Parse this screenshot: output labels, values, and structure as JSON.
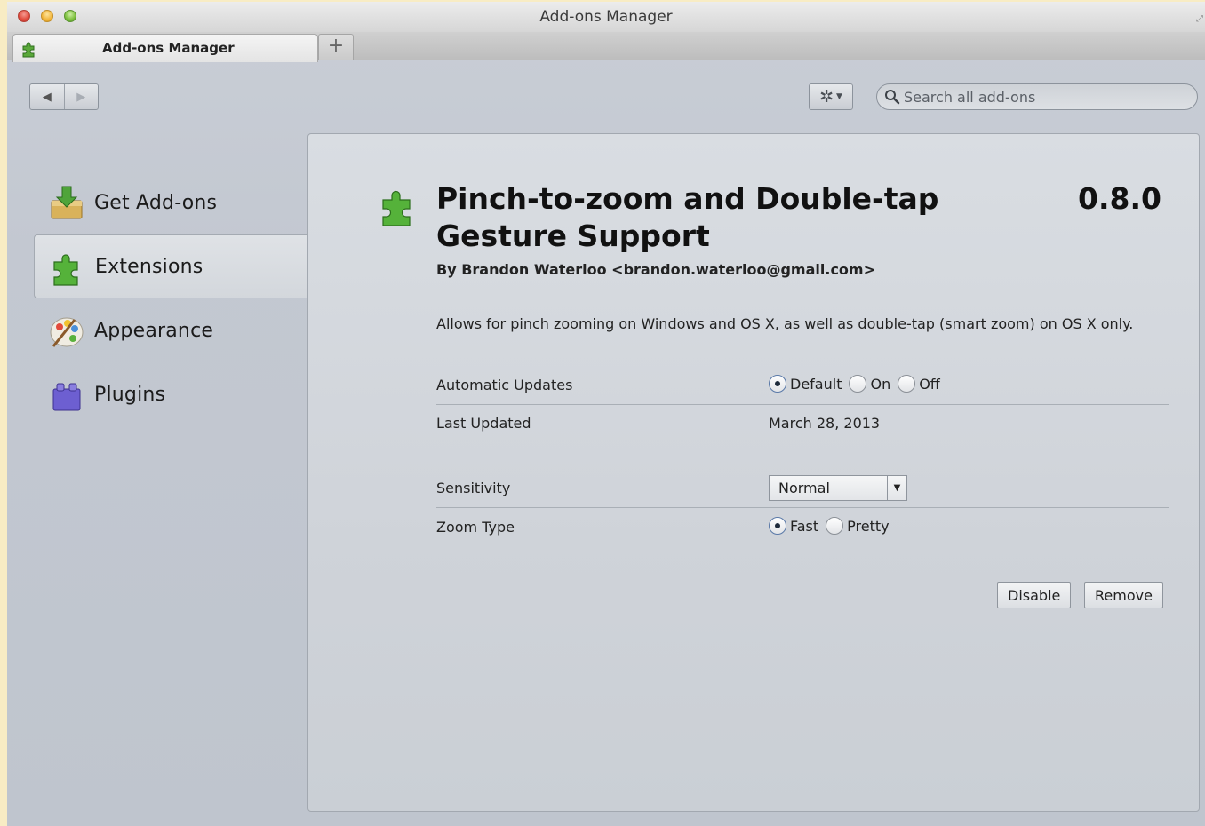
{
  "window": {
    "title": "Add-ons Manager"
  },
  "tab": {
    "label": "Add-ons Manager",
    "new_tab_label": "+"
  },
  "toolbar": {
    "back_glyph": "◀",
    "forward_glyph": "▶",
    "gear_glyph": "✲",
    "search_placeholder": "Search all add-ons"
  },
  "sidebar": {
    "items": [
      {
        "label": "Get Add-ons",
        "icon": "get-addons-icon",
        "selected": false
      },
      {
        "label": "Extensions",
        "icon": "extensions-icon",
        "selected": true
      },
      {
        "label": "Appearance",
        "icon": "appearance-icon",
        "selected": false
      },
      {
        "label": "Plugins",
        "icon": "plugins-icon",
        "selected": false
      }
    ]
  },
  "addon": {
    "name": "Pinch-to-zoom and Double-tap Gesture Support",
    "version": "0.8.0",
    "author": "By Brandon Waterloo <brandon.waterloo@gmail.com>",
    "description": "Allows for pinch zooming on Windows and OS X, as well as double-tap (smart zoom) on OS X only.",
    "details": {
      "automatic_updates_label": "Automatic Updates",
      "automatic_updates_options": [
        "Default",
        "On",
        "Off"
      ],
      "automatic_updates_selected": "Default",
      "last_updated_label": "Last Updated",
      "last_updated_value": "March 28, 2013"
    },
    "preferences": {
      "sensitivity_label": "Sensitivity",
      "sensitivity_value": "Normal",
      "zoom_type_label": "Zoom Type",
      "zoom_type_options": [
        "Fast",
        "Pretty"
      ],
      "zoom_type_selected": "Fast"
    },
    "buttons": {
      "disable": "Disable",
      "remove": "Remove"
    }
  },
  "colors": {
    "window_bg": "#c6cbd3",
    "panel_bg": "#d4d8de",
    "desktop_bg": "#f8ecc4"
  }
}
